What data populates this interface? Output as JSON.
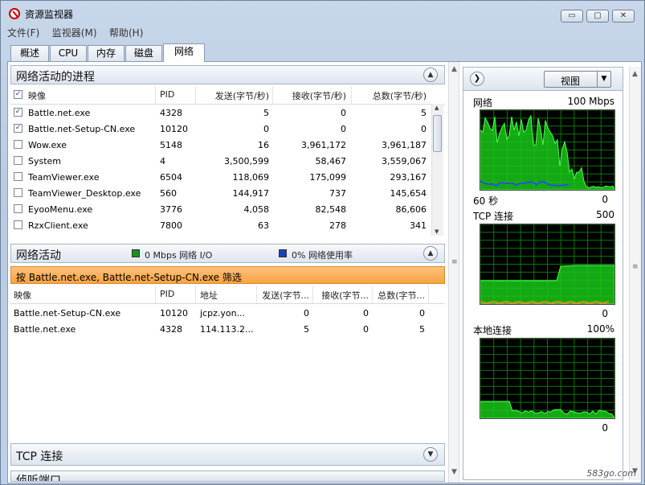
{
  "window": {
    "title": "资源监视器",
    "buttons": [
      "▭",
      "▢",
      "✕"
    ]
  },
  "menu": [
    "文件(F)",
    "监视器(M)",
    "帮助(H)"
  ],
  "tabs": [
    "概述",
    "CPU",
    "内存",
    "磁盘",
    "网络"
  ],
  "processes": {
    "title": "网络活动的进程",
    "headers": {
      "image": "映像",
      "pid": "PID",
      "send": "发送(字节/秒)",
      "recv": "接收(字节/秒)",
      "total": "总数(字节/秒)"
    },
    "rows": [
      {
        "checked": true,
        "image": "Battle.net.exe",
        "pid": "4328",
        "send": "5",
        "recv": "0",
        "total": "5"
      },
      {
        "checked": true,
        "image": "Battle.net-Setup-CN.exe",
        "pid": "10120",
        "send": "0",
        "recv": "0",
        "total": "0"
      },
      {
        "checked": false,
        "image": "Wow.exe",
        "pid": "5148",
        "send": "16",
        "recv": "3,961,172",
        "total": "3,961,187"
      },
      {
        "checked": false,
        "image": "System",
        "pid": "4",
        "send": "3,500,599",
        "recv": "58,467",
        "total": "3,559,067"
      },
      {
        "checked": false,
        "image": "TeamViewer.exe",
        "pid": "6504",
        "send": "118,069",
        "recv": "175,099",
        "total": "293,167"
      },
      {
        "checked": false,
        "image": "TeamViewer_Desktop.exe",
        "pid": "560",
        "send": "144,917",
        "recv": "737",
        "total": "145,654"
      },
      {
        "checked": false,
        "image": "EyooMenu.exe",
        "pid": "3776",
        "send": "4,058",
        "recv": "82,548",
        "total": "86,606"
      },
      {
        "checked": false,
        "image": "RzxClient.exe",
        "pid": "7800",
        "send": "63",
        "recv": "278",
        "total": "341"
      }
    ]
  },
  "activity": {
    "title": "网络活动",
    "io_legend": "0 Mbps 网络 I/O",
    "usage_legend": "0% 网络使用率",
    "io_color": "#1e8f1e",
    "usage_color": "#1a3fbf",
    "filter": "按 Battle.net.exe, Battle.net-Setup-CN.exe 筛选",
    "headers": {
      "image": "映像",
      "pid": "PID",
      "address": "地址",
      "send": "发送(字节...",
      "recv": "接收(字节...",
      "total": "总数(字节..."
    },
    "rows": [
      {
        "image": "Battle.net-Setup-CN.exe",
        "pid": "10120",
        "address": "jcpz.yon...",
        "send": "0",
        "recv": "0",
        "total": "0"
      },
      {
        "image": "Battle.net.exe",
        "pid": "4328",
        "address": "114.113.2...",
        "send": "5",
        "recv": "0",
        "total": "5"
      }
    ]
  },
  "tcp": {
    "title": "TCP 连接"
  },
  "listen": {
    "title": "侦听端口"
  },
  "view_button": "视图",
  "graphs": [
    {
      "name": "网络",
      "max": "100 Mbps",
      "left_bottom": "60 秒",
      "right_bottom": "0"
    },
    {
      "name": "TCP 连接",
      "max": "500",
      "right_bottom": "0"
    },
    {
      "name": "本地连接",
      "max": "100%",
      "right_bottom": "0"
    }
  ],
  "watermark": "583go.com"
}
